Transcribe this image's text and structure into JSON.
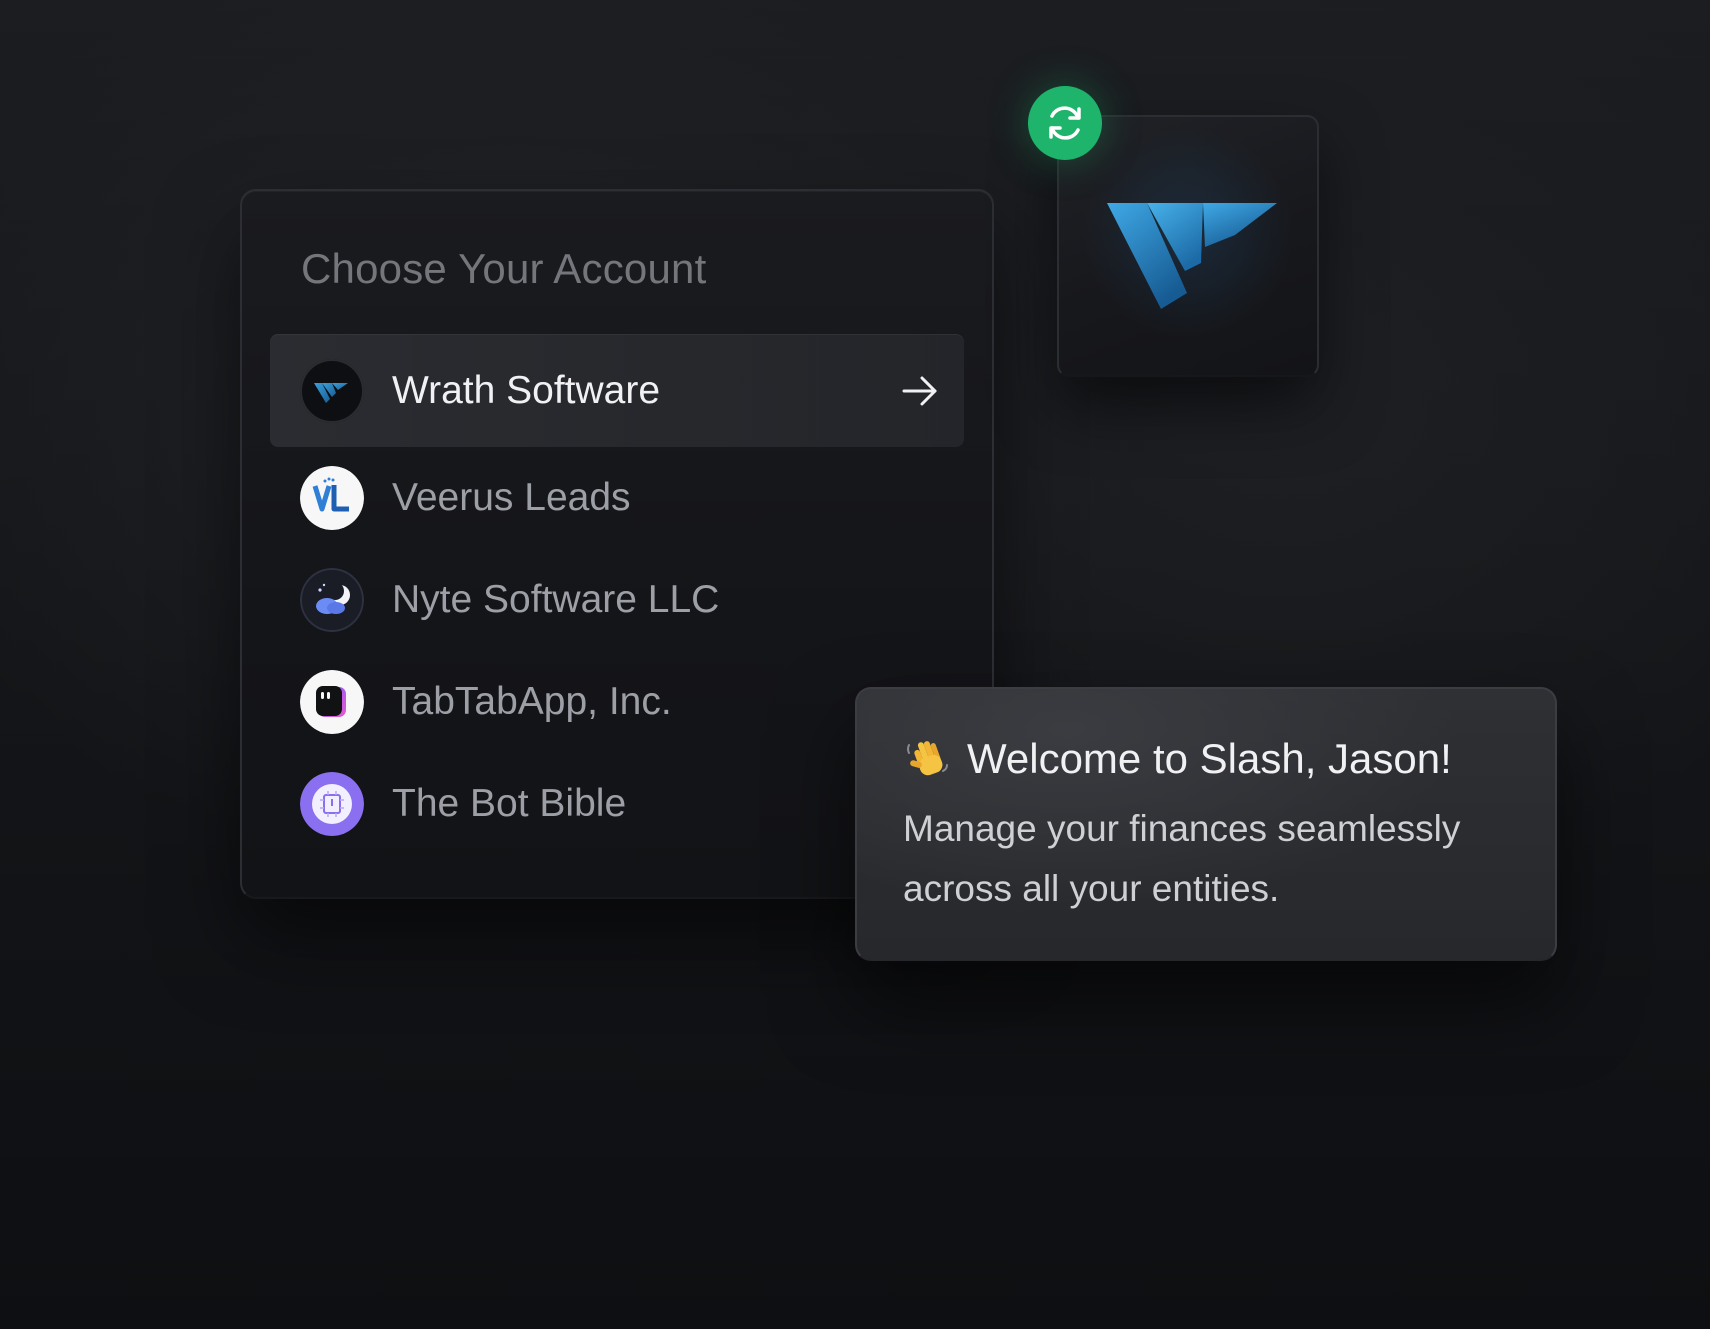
{
  "account_panel": {
    "title": "Choose Your Account",
    "accounts": [
      {
        "name": "Wrath Software",
        "selected": true,
        "icon": "wrath-logo-icon"
      },
      {
        "name": "Veerus Leads",
        "selected": false,
        "icon": "veerus-logo-icon"
      },
      {
        "name": "Nyte Software LLC",
        "selected": false,
        "icon": "nyte-logo-icon"
      },
      {
        "name": "TabTabApp, Inc.",
        "selected": false,
        "icon": "tabtab-logo-icon"
      },
      {
        "name": "The Bot Bible",
        "selected": false,
        "icon": "bot-bible-logo-icon"
      }
    ],
    "selected_icon": "arrow-right-icon"
  },
  "logo_tile": {
    "icon": "wrath-logo-icon",
    "badge_icon": "refresh-icon"
  },
  "welcome": {
    "emoji_icon": "waving-hand-icon",
    "heading": "Welcome to Slash, Jason!",
    "body": "Manage your finances seamlessly across all your entities."
  },
  "colors": {
    "background": "#141619",
    "panel": "#17181c",
    "selected_row": "#2a2c31",
    "accent_green": "#1fb46b",
    "brand_blue": "#2a8fd0"
  }
}
